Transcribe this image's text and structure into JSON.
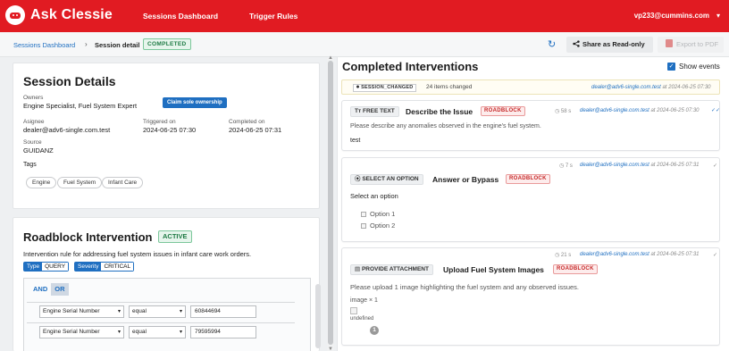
{
  "header": {
    "app_name": "Ask Clessie",
    "nav": [
      "Sessions Dashboard",
      "Trigger Rules"
    ],
    "user": "vp233@cummins.com",
    "user_caret": "▾"
  },
  "subbar": {
    "breadcrumb_link": "Sessions Dashboard",
    "breadcrumb_sep": "›",
    "breadcrumb_current": "Session detail",
    "status_badge": "COMPLETED",
    "refresh_glyph": "↻",
    "share_label": "Share as Read-only",
    "export_label": "Export to PDF"
  },
  "details": {
    "title": "Session Details",
    "owners_label": "Owners",
    "owners_value": "Engine Specialist, Fuel System Expert",
    "claim_label": "Claim sole ownership",
    "assignee_label": "Asignee",
    "assignee_value": "dealer@adv6-single.com.test",
    "triggered_label": "Triggered on",
    "triggered_value": "2024-06-25 07:30",
    "completed_label": "Completed on",
    "completed_value": "2024-06-25 07:31",
    "source_label": "Source",
    "source_value": "GUIDANZ",
    "tags_label": "Tags",
    "tags": [
      "Engine",
      "Fuel System",
      "Infant Care"
    ]
  },
  "roadblock": {
    "title": "Roadblock Intervention",
    "status": "ACTIVE",
    "description": "Intervention rule for addressing fuel system issues in infant care work orders.",
    "type_key": "Type",
    "type_value": "QUERY",
    "severity_key": "Severity",
    "severity_value": "CRITICAL",
    "and_label": "AND",
    "or_label": "OR",
    "rules": [
      {
        "field": "Engine Serial Number",
        "operator": "equal",
        "value": "60844694"
      },
      {
        "field": "Engine Serial Number",
        "operator": "equal",
        "value": "79595994"
      }
    ]
  },
  "interventions": {
    "title": "Completed Interventions",
    "show_events_label": "Show events",
    "event": {
      "code": "SESSION_CHANGED",
      "summary": "24 items changed",
      "who": "dealer@adv6-single.com.test",
      "at": "at 2024-06-25 07:30"
    },
    "items": [
      {
        "type": "FREE TEXT",
        "type_icon": "Tт",
        "title": "Describe the Issue",
        "tag": "ROADBLOCK",
        "timer": "58 s",
        "who": "dealer@adv6-single.com.test",
        "at": "at 2024-06-25 07:30",
        "prompt": "Please describe any anomalies observed in the engine's fuel system.",
        "answer": "test"
      },
      {
        "type": "SELECT AN OPTION",
        "title": "Answer or Bypass",
        "tag": "ROADBLOCK",
        "timer": "7 s",
        "who": "dealer@adv6-single.com.test",
        "at": "at 2024-06-25 07:31",
        "prompt": "Select an option",
        "options": [
          "Option 1",
          "Option 2"
        ]
      },
      {
        "type": "PROVIDE ATTACHMENT",
        "title": "Upload Fuel System Images",
        "tag": "ROADBLOCK",
        "timer": "21 s",
        "who": "dealer@adv6-single.com.test",
        "at": "at 2024-06-25 07:31",
        "prompt": "Please upload 1 image highlighting the fuel system and any observed issues.",
        "image_label": "image × 1",
        "image_alt": "undefined",
        "count": "1"
      }
    ]
  }
}
